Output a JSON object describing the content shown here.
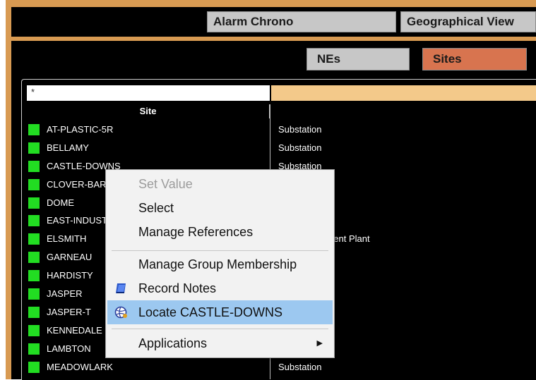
{
  "tabs": [
    {
      "label": "Alarm Chrono"
    },
    {
      "label": "Geographical View"
    }
  ],
  "subtabs": [
    {
      "label": "NEs",
      "bg": "#c7c7c7"
    },
    {
      "label": "Sites",
      "bg": "#d8744f"
    }
  ],
  "filter": {
    "value": "*"
  },
  "table": {
    "column_header": "Site",
    "rows": [
      {
        "site": "AT-PLASTIC-5R",
        "type": "Substation"
      },
      {
        "site": "BELLAMY",
        "type": "Substation"
      },
      {
        "site": "CASTLE-DOWNS",
        "type": "Substation"
      },
      {
        "site": "CLOVER-BAR",
        "type": ""
      },
      {
        "site": "DOME",
        "type": ""
      },
      {
        "site": "EAST-INDUSTRIAL",
        "type": ""
      },
      {
        "site": "ELSMITH",
        "type": "Water Treatment Plant"
      },
      {
        "site": "GARNEAU",
        "type": ""
      },
      {
        "site": "HARDISTY",
        "type": ""
      },
      {
        "site": "JASPER",
        "type": ""
      },
      {
        "site": "JASPER-T",
        "type": ""
      },
      {
        "site": "KENNEDALE",
        "type": ""
      },
      {
        "site": "LAMBTON",
        "type": ""
      },
      {
        "site": "MEADOWLARK",
        "type": "Substation"
      }
    ]
  },
  "context_menu": {
    "items": [
      {
        "label": "Set Value",
        "disabled": true
      },
      {
        "label": "Select"
      },
      {
        "label": "Manage References"
      },
      {
        "label": "Manage Group Membership"
      },
      {
        "label": "Record Notes",
        "icon": "notes-icon"
      },
      {
        "label": "Locate CASTLE-DOWNS",
        "icon": "locate-globe-icon",
        "highlighted": true
      },
      {
        "label": "Applications",
        "submenu": true
      }
    ]
  },
  "colors": {
    "frame": "#d89a52",
    "status_ok": "#22dd22",
    "menu_highlight": "#9cc8f0"
  }
}
